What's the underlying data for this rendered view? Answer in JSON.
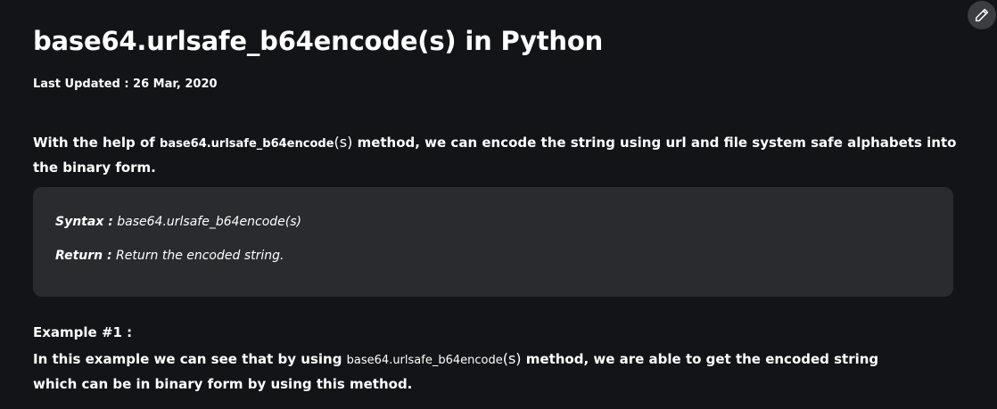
{
  "article": {
    "title": "base64.urlsafe_b64encode(s) in Python",
    "last_updated": "Last Updated : 26 Mar, 2020",
    "intro": {
      "prefix": "With the help of ",
      "code": "base64.urlsafe_b64encode",
      "code_arg": "(s)",
      "suffix": " method, we can encode the string using url and file system safe alphabets into the binary form."
    },
    "syntax_box": {
      "syntax_label": "Syntax :",
      "syntax_value": " base64.urlsafe_b64encode(s)",
      "return_label": "Return :",
      "return_value": " Return the encoded string."
    },
    "example": {
      "heading": "Example #1 :",
      "prefix": "In this example we can see that by using ",
      "code": "base64.urlsafe_b64encode",
      "code_arg": "(s)",
      "suffix": " method, we are able to get the encoded string which can be in binary form by using this method."
    }
  },
  "edit_button": {
    "icon": "pencil-icon",
    "color": "#3b3d42"
  },
  "colors": {
    "background": "#131417",
    "box_background": "#2a2b2e",
    "text": "#ffffff"
  }
}
